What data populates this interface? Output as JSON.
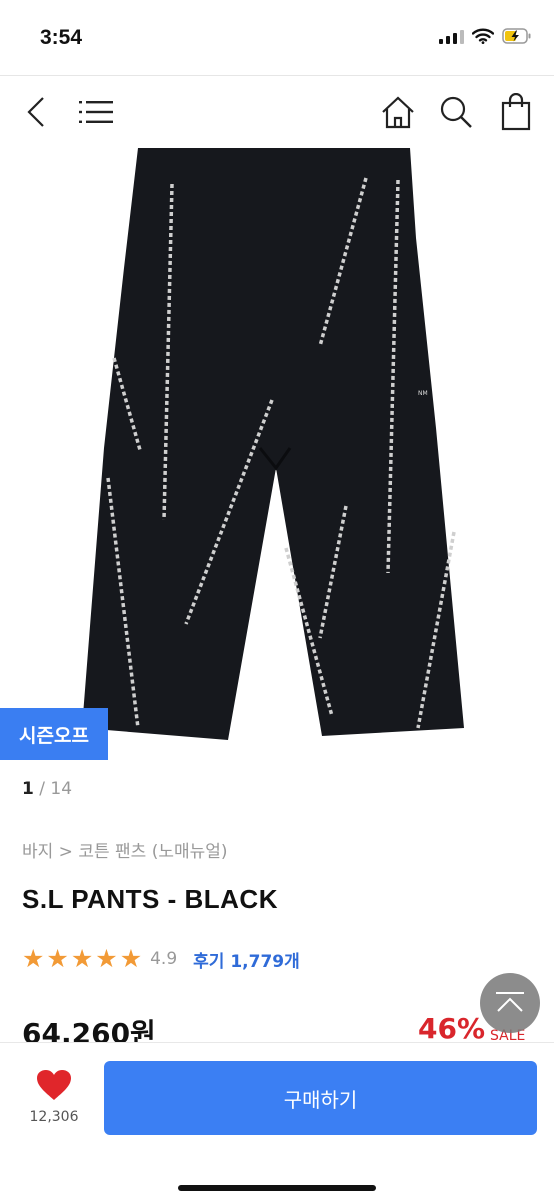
{
  "status": {
    "time": "3:54"
  },
  "nav": {
    "back_icon": "chevron-left-icon",
    "menu_icon": "hamburger-menu-icon",
    "home_icon": "home-icon",
    "search_icon": "search-icon",
    "cart_icon": "shopping-bag-icon"
  },
  "product": {
    "badge": "시즌오프",
    "pager_current": "1",
    "pager_total": "/ 14",
    "breadcrumb": "바지 > 코튼 팬츠 (노매뉴얼)",
    "title": "S.L PANTS - BLACK",
    "rating": "4.9",
    "stars": 5,
    "review_label": "후기 1,779개",
    "price": "64,260원",
    "discount": "46%",
    "sale_label": "SALE"
  },
  "bottom": {
    "like_count": "12,306",
    "buy_label": "구매하기"
  },
  "colors": {
    "accent": "#3b7ff3",
    "sale_red": "#d9262c",
    "star": "#f29a36",
    "heart": "#e0262b"
  }
}
